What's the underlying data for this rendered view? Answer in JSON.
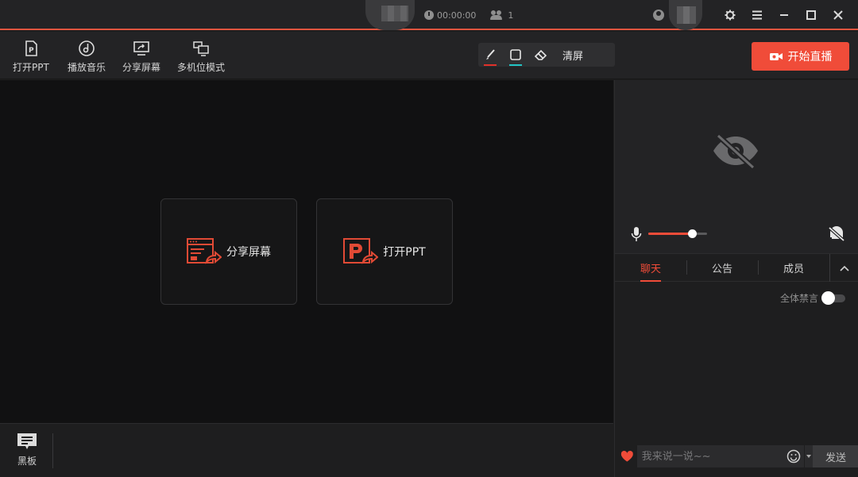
{
  "titlebar": {
    "timer": "00:00:00",
    "viewer_count": "1"
  },
  "toolbar": {
    "tools": [
      {
        "label": "打开PPT",
        "icon": "ppt-file-icon"
      },
      {
        "label": "播放音乐",
        "icon": "music-disc-icon"
      },
      {
        "label": "分享屏幕",
        "icon": "share-screen-icon"
      },
      {
        "label": "多机位模式",
        "icon": "multi-camera-icon"
      }
    ],
    "draw": {
      "pen_color": "#e0302a",
      "shape_color": "#22c5c5",
      "clear_label": "清屏"
    },
    "start_label": "开始直播"
  },
  "stage": {
    "share_label": "分享屏幕",
    "ppt_label": "打开PPT"
  },
  "bottom": {
    "blackboard_label": "黑板"
  },
  "right": {
    "volume": 0.74,
    "tabs": [
      {
        "label": "聊天",
        "active": true
      },
      {
        "label": "公告",
        "active": false
      },
      {
        "label": "成员",
        "active": false
      }
    ],
    "mute_all_label": "全体禁言",
    "chat_placeholder": "我来说一说~~",
    "send_label": "发送"
  },
  "colors": {
    "accent": "#f04c39",
    "background": "#1e1e1f",
    "stage": "#111112"
  }
}
